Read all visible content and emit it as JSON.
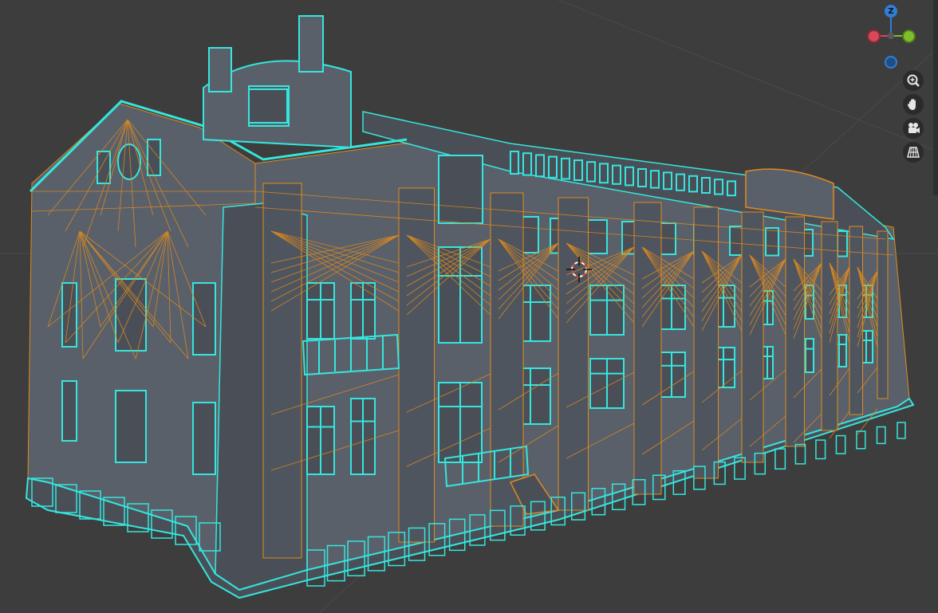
{
  "app": {
    "view": "3D Viewport",
    "shading": "wireframe"
  },
  "colors": {
    "background": "#3d3d3d",
    "wall": "#5a6069",
    "wall_dark": "#4a4f57",
    "wire_selected": "#e08a1e",
    "wire_active": "#35e6de",
    "grid_line": "#4a4a4a",
    "axis_x": "#d9485a",
    "axis_y": "#7dbe2c",
    "axis_z": "#2f7fd6",
    "cursor": "#ffffff",
    "cursor_accent": "#d94b36"
  },
  "navigation_gizmo": {
    "z_label": "Z",
    "axes": [
      "x",
      "y",
      "z",
      "-x",
      "-y",
      "-z"
    ]
  },
  "toolbar": {
    "buttons": [
      {
        "name": "zoom-button",
        "icon": "zoom-icon"
      },
      {
        "name": "pan-button",
        "icon": "hand-icon"
      },
      {
        "name": "camera-view-button",
        "icon": "camera-icon"
      },
      {
        "name": "perspective-toggle-button",
        "icon": "grid-icon"
      }
    ]
  }
}
